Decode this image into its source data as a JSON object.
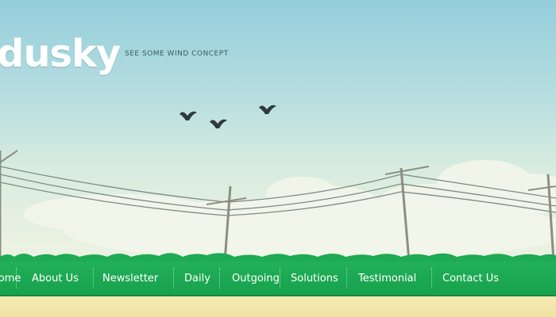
{
  "site": {
    "logo_text": "dusky",
    "tagline": "SEE SOME WIND CONCEPT"
  },
  "nav": {
    "items": [
      {
        "label": "Home",
        "name": "nav-item-home"
      },
      {
        "label": "About Us",
        "name": "nav-item-about-us"
      },
      {
        "label": "Newsletter",
        "name": "nav-item-newsletter"
      },
      {
        "label": "Daily",
        "name": "nav-item-daily"
      },
      {
        "label": "Outgoing",
        "name": "nav-item-outgoing"
      },
      {
        "label": "Solutions",
        "name": "nav-item-solutions"
      },
      {
        "label": "Testimonial",
        "name": "nav-item-testimonial"
      },
      {
        "label": "Contact Us",
        "name": "nav-item-contact-us"
      }
    ]
  },
  "colors": {
    "sky_top": "#93cedb",
    "nav_green": "#1aa650",
    "ground_sand": "#f1e6aa",
    "bird": "#2f3a3f"
  },
  "icons": {
    "birds": "birds-icon",
    "power_lines": "power-lines-illustration"
  }
}
